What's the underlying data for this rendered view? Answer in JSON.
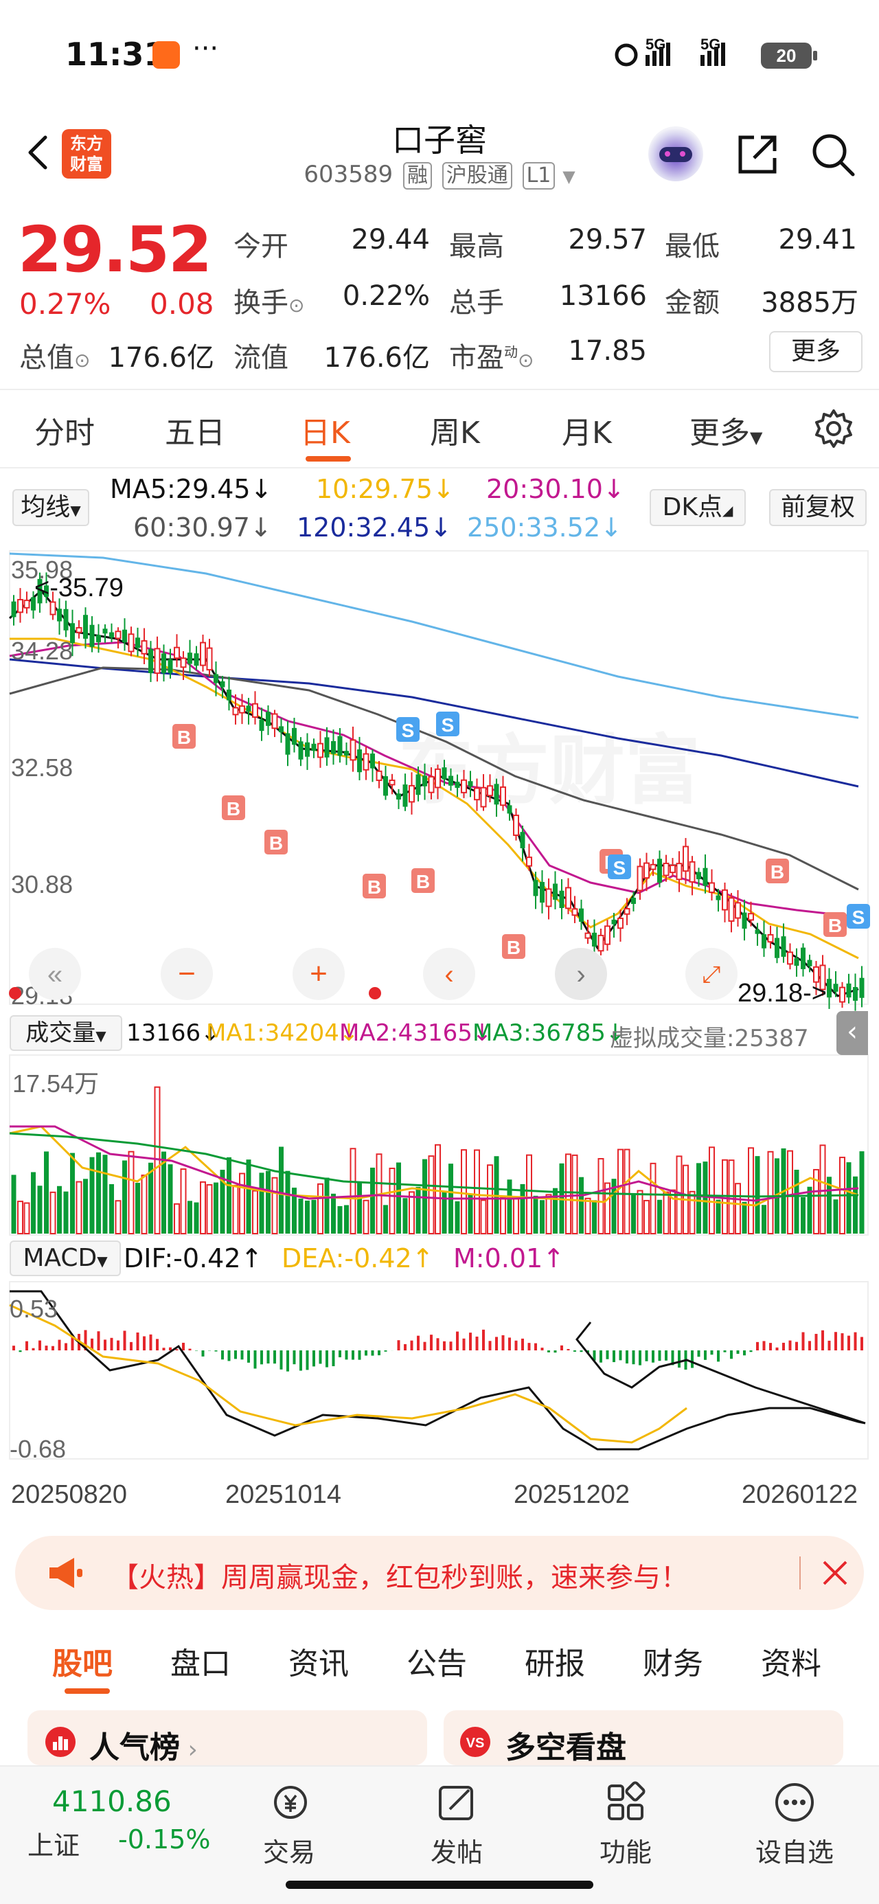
{
  "status_bar": {
    "time": "11:31",
    "dots": "···",
    "network": "5G",
    "battery": "20"
  },
  "header": {
    "stock_name": "口子窖",
    "stock_code": "603589",
    "tags": [
      "融",
      "沪股通",
      "L1"
    ],
    "brand_logo": "东方\n财富"
  },
  "quote": {
    "price": "29.52",
    "change_pct": "0.27%",
    "change_abs": "0.08",
    "open_label": "今开",
    "open": "29.44",
    "high_label": "最高",
    "high": "29.57",
    "low_label": "最低",
    "low": "29.41",
    "turnover_label": "换手",
    "turnover": "0.22%",
    "volume_label": "总手",
    "volume": "13166",
    "amount_label": "金额",
    "amount": "3885万",
    "mktcap_label": "总值",
    "mktcap": "176.6亿",
    "float_label": "流值",
    "float_cap": "176.6亿",
    "pe_label": "市盈",
    "pe_sup": "动",
    "pe": "17.85",
    "more_button": "更多"
  },
  "period_tabs": [
    "分时",
    "五日",
    "日K",
    "周K",
    "月K",
    "更多"
  ],
  "active_period": "日K",
  "ma_bar": {
    "selector": "均线",
    "ma5": "MA5:29.45↓",
    "ma10": "10:29.75↓",
    "ma20": "20:30.10↓",
    "ma60": "60:30.97↓",
    "ma120": "120:32.45↓",
    "ma250": "250:33.52↓",
    "dk_button": "DK点",
    "adjust_button": "前复权"
  },
  "kline": {
    "y_labels": [
      "35.98",
      "34.28",
      "32.58",
      "30.88",
      "29.18"
    ],
    "max_label": "<-35.79",
    "min_label": "29.18->",
    "watermark": "东方财富"
  },
  "volume_bar": {
    "selector": "成交量",
    "vol": "13166↓",
    "ma1": "MA1:34204↓",
    "ma2": "MA2:43165↓",
    "ma3": "MA3:36785↓",
    "virtual": "虚拟成交量:25387",
    "scale": "17.54万"
  },
  "macd_bar": {
    "selector": "MACD",
    "dif": "DIF:-0.42↑",
    "dea": "DEA:-0.42↑",
    "m": "M:0.01↑",
    "top_label": "0.53",
    "bottom_label": "-0.68"
  },
  "x_dates": [
    "20250820",
    "20251014",
    "20251202",
    "20260122"
  ],
  "banner": {
    "text": "【火热】周周赢现金，红包秒到账，速来参与！"
  },
  "content_tabs": [
    "股吧",
    "盘口",
    "资讯",
    "公告",
    "研报",
    "财务",
    "资料"
  ],
  "active_content_tab": "股吧",
  "cards": {
    "popularity": "人气榜",
    "bull_bear": "多空看盘"
  },
  "bottom_nav": {
    "index_value": "4110.86",
    "index_name": "上证",
    "index_change": "-0.15%",
    "items": [
      "交易",
      "发帖",
      "功能",
      "设自选"
    ]
  },
  "colors": {
    "up": "#e5262b",
    "down": "#0a9b36",
    "ma5": "#111111",
    "ma10": "#f2b705",
    "ma20": "#c2188f",
    "ma60": "#555555",
    "ma120": "#1a2b9c",
    "ma250": "#63b5e8",
    "accent": "#f05a1d"
  },
  "chart_data": {
    "type": "candlestick",
    "y_axis_labels": [
      "35.98",
      "34.28",
      "32.58",
      "30.88",
      "29.18"
    ],
    "x_axis_labels": [
      "20250820",
      "20251014",
      "20251202",
      "20260122"
    ],
    "series": [
      {
        "name": "MA250",
        "values": [
          36.2,
          35.8,
          35.2,
          34.6,
          34.1,
          33.5
        ]
      },
      {
        "name": "MA120",
        "values": [
          34.3,
          34.0,
          33.6,
          33.1,
          32.8,
          32.45
        ]
      },
      {
        "name": "MA60",
        "values": [
          33.9,
          34.3,
          34.0,
          33.2,
          32.1,
          31.0
        ]
      },
      {
        "name": "MA20",
        "values": [
          34.6,
          34.6,
          33.4,
          32.5,
          31.3,
          30.1
        ]
      }
    ],
    "markers": [
      "B",
      "B",
      "B",
      "B",
      "S",
      "S",
      "B",
      "B",
      "B",
      "S",
      "B",
      "B",
      "S"
    ]
  }
}
